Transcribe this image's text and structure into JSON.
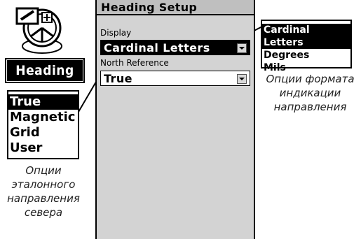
{
  "app": {
    "icon_name": "heading-compass-icon",
    "badge_label": "Heading"
  },
  "screen": {
    "title": "Heading Setup",
    "display": {
      "label": "Display",
      "value": "Cardinal Letters"
    },
    "north_reference": {
      "label": "North Reference",
      "value": "True"
    }
  },
  "north_popup": {
    "options": [
      "True",
      "Magnetic",
      "Grid",
      "User"
    ],
    "selected": "True"
  },
  "format_popup": {
    "options": [
      "Cardinal Letters",
      "Degrees",
      "Mils"
    ],
    "selected": "Cardinal Letters"
  },
  "captions": {
    "north": "Опции эталонного направления севера",
    "format": "Опции формата индикации направления"
  },
  "colors": {
    "screen_bg": "#d3d3d3",
    "highlight": "#000000"
  }
}
